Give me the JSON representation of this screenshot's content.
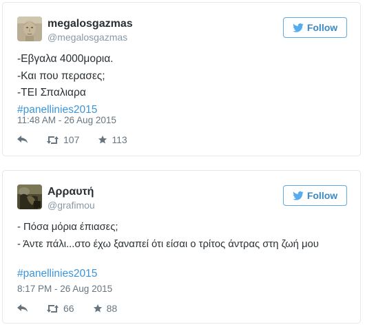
{
  "follow_label": "Follow",
  "tweets": [
    {
      "name": "megalosgazmas",
      "handle": "@megalosgazmas",
      "lines": [
        "-Εβγαλα 4000μορια.",
        "-Και που περασες;",
        "-ΤΕΙ Σπαλιαρα"
      ],
      "hashtag": "#panellinies2015",
      "timestamp": "11:48 AM - 26 Aug 2015",
      "retweets": "107",
      "favorites": "113",
      "avatar_icon": "statue-avatar-icon"
    },
    {
      "name": "Αρραυτή",
      "handle": "@grafimou",
      "lines": [
        "- Πόσα μόρια έπιασες;",
        "- Άντε πάλι...στο έχω ξαναπεί ότι είσαι ο τρίτος άντρας στη ζωή μου"
      ],
      "hashtag": "#panellinies2015",
      "timestamp": "8:17 PM - 26 Aug 2015",
      "retweets": "66",
      "favorites": "88",
      "avatar_icon": "photo-avatar-icon"
    }
  ],
  "colors": {
    "follow_border": "#5ea9dd",
    "follow_text": "#3b88c3",
    "hashtag": "#3b94d9",
    "muted": "#66757f",
    "card_border": "#e1e8ed"
  }
}
